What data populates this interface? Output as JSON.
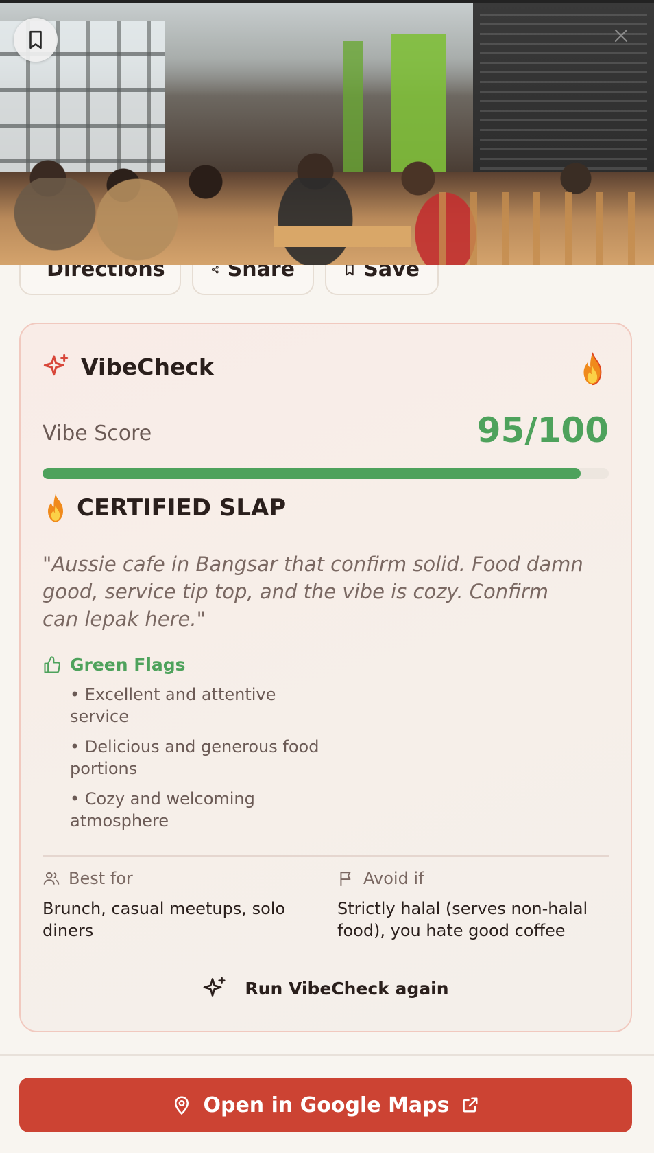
{
  "hero": {
    "image_alt": "Cafe interior photo"
  },
  "actions": {
    "directions_label": "Directions",
    "share_label": "Share",
    "save_label": "Save"
  },
  "vibecheck": {
    "title": "VibeCheck",
    "header_emoji": "🔥",
    "score_label": "Vibe Score",
    "score_text": "95/100",
    "score_fraction": 0.95,
    "verdict_emoji": "🔥",
    "verdict": "CERTIFIED SLAP",
    "quote": "\"Aussie cafe in Bangsar that confirm solid. Food damn good, service tip top, and the vibe is cozy. Confirm can lepak here.\"",
    "green_flags_title": "Green Flags",
    "green_flags": [
      "• Excellent and attentive service",
      "• Delicious and generous food portions",
      "• Cozy and welcoming atmosphere"
    ],
    "best_for_title": "Best for",
    "best_for": "Brunch, casual meetups, solo diners",
    "avoid_if_title": "Avoid if",
    "avoid_if": "Strictly halal (serves non-halal food), you hate good coffee",
    "run_again_label": "Run VibeCheck again"
  },
  "footer": {
    "maps_label": "Open in Google Maps"
  },
  "colors": {
    "accent_red": "#cc4333",
    "score_green": "#4ea25c"
  },
  "icons": [
    "bookmark-icon",
    "close-icon",
    "navigation-icon",
    "share-icon",
    "bookmark-icon",
    "sparkles-icon",
    "fire-icon",
    "thumbs-up-icon",
    "users-icon",
    "flag-icon",
    "map-pin-icon",
    "external-link-icon"
  ]
}
